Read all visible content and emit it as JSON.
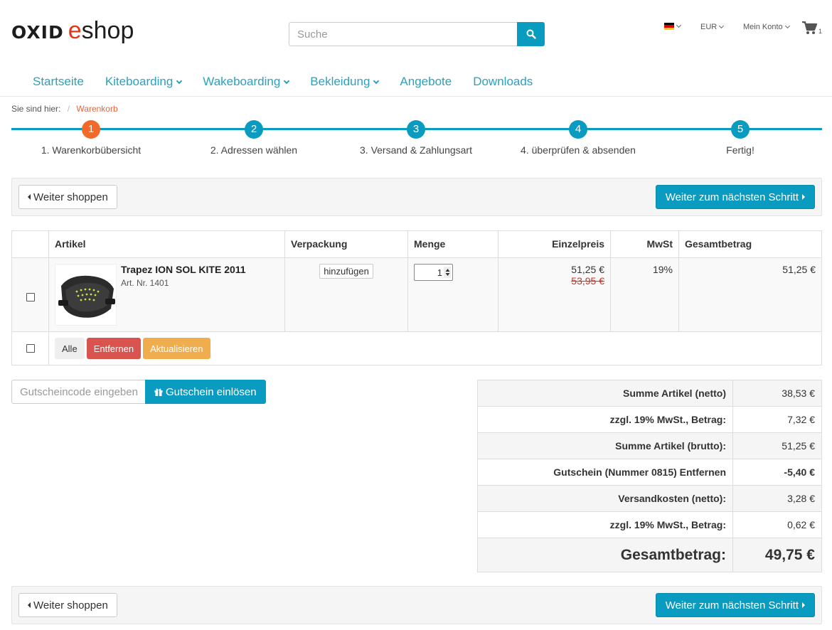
{
  "header": {
    "logo_left": "OXID",
    "logo_e": "e",
    "logo_right": "shop",
    "search_placeholder": "Suche",
    "currency": "EUR",
    "account": "Mein Konto",
    "cart_count": "1",
    "icons": [
      "search-icon",
      "flag-de-icon",
      "cart-icon"
    ]
  },
  "nav": {
    "items": [
      {
        "label": "Startseite",
        "dropdown": false
      },
      {
        "label": "Kiteboarding",
        "dropdown": true
      },
      {
        "label": "Wakeboarding",
        "dropdown": true
      },
      {
        "label": "Bekleidung",
        "dropdown": true
      },
      {
        "label": "Angebote",
        "dropdown": false
      },
      {
        "label": "Downloads",
        "dropdown": false
      }
    ]
  },
  "breadcrumb": {
    "prefix": "Sie sind hier:",
    "sep": "/",
    "current": "Warenkorb"
  },
  "steps": [
    {
      "num": "1",
      "label": "1. Warenkorbübersicht",
      "active": true
    },
    {
      "num": "2",
      "label": "2. Adressen wählen"
    },
    {
      "num": "3",
      "label": "3. Versand & Zahlungsart"
    },
    {
      "num": "4",
      "label": "4. überprüfen & absenden"
    },
    {
      "num": "5",
      "label": "Fertig!"
    }
  ],
  "actions": {
    "back": "Weiter shoppen",
    "next": "Weiter zum nächsten Schritt"
  },
  "table": {
    "headers": [
      "Artikel",
      "Verpackung",
      "Menge",
      "Einzelpreis",
      "MwSt",
      "Gesamtbetrag"
    ],
    "item": {
      "name": "Trapez ION SOL KITE 2011",
      "artnr": "Art. Nr. 1401",
      "packaging_button": "hinzufügen",
      "qty": "1",
      "price": "51,25 €",
      "old_price": "53,95 €",
      "vat": "19%",
      "total": "51,25 €"
    },
    "footer_buttons": {
      "all": "Alle",
      "remove": "Entfernen",
      "update": "Aktualisieren"
    }
  },
  "voucher": {
    "placeholder": "Gutscheincode eingeben",
    "button": "Gutschein einlösen"
  },
  "summary": [
    {
      "label": "Summe Artikel (netto)",
      "value": "38,53 €"
    },
    {
      "label": "zzgl. 19% MwSt., Betrag:",
      "value": "7,32 €"
    },
    {
      "label": "Summe Artikel (brutto):",
      "value": "51,25 €"
    },
    {
      "label": "Gutschein (Nummer 0815) Entfernen",
      "value": "-5,40 €"
    },
    {
      "label": "Versandkosten (netto):",
      "value": "3,28 €"
    },
    {
      "label": "zzgl. 19% MwSt., Betrag:",
      "value": "0,62 €"
    },
    {
      "label": "Gesamtbetrag:",
      "value": "49,75 €"
    }
  ],
  "colors": {
    "accent": "#0a9bc1",
    "active_step": "#f26a2a",
    "danger": "#d9534f",
    "warning": "#f0ad4e",
    "logo_e": "#e53517"
  }
}
